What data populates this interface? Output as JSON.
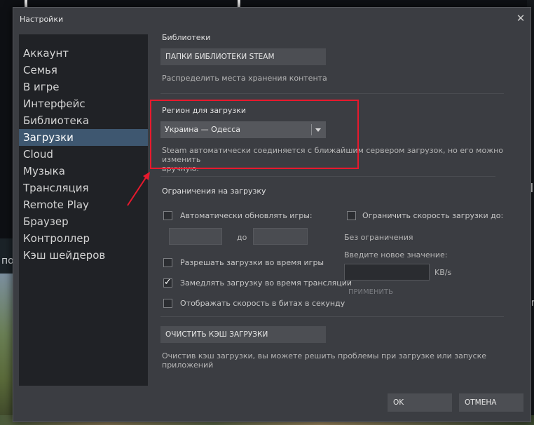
{
  "window": {
    "title": "Настройки"
  },
  "background": {
    "left_text": "по",
    "right_text_1": "Л",
    "right_text_2": "Cr"
  },
  "sidebar": {
    "items": [
      {
        "label": "Аккаунт"
      },
      {
        "label": "Семья"
      },
      {
        "label": "В игре"
      },
      {
        "label": "Интерфейс"
      },
      {
        "label": "Библиотека"
      },
      {
        "label": "Загрузки",
        "active": true
      },
      {
        "label": "Cloud"
      },
      {
        "label": "Музыка"
      },
      {
        "label": "Трансляция"
      },
      {
        "label": "Remote Play"
      },
      {
        "label": "Браузер"
      },
      {
        "label": "Контроллер"
      },
      {
        "label": "Кэш шейдеров"
      }
    ]
  },
  "libraries": {
    "heading": "Библиотеки",
    "button": "ПАПКИ БИБЛИОТЕКИ STEAM",
    "description": "Распределить места хранения контента"
  },
  "region": {
    "heading": "Регион для загрузки",
    "selected": "Украина — Одесса",
    "description_line1": "Steam автоматически соединяется с ближайшим сервером загрузок, но его можно изменить",
    "description_line2": "вручную."
  },
  "limits": {
    "heading": "Ограничения на загрузку",
    "auto_update": {
      "label": "Автоматически обновлять игры:",
      "checked": false
    },
    "time_to": "до",
    "limit_speed": {
      "label": "Ограничить скорость загрузки до:",
      "checked": false
    },
    "no_limit": "Без ограничения",
    "enter_value": "Введите новое значение:",
    "unit": "KB/s",
    "apply": "ПРИМЕНИТЬ",
    "allow_during_game": {
      "label": "Разрешать загрузки во время игры",
      "checked": false
    },
    "throttle_streaming": {
      "label": "Замедлять загрузку во время трансляции",
      "checked": true
    },
    "show_bits": {
      "label": "Отображать скорость в битах в секунду",
      "checked": false
    }
  },
  "cache": {
    "button": "ОЧИСТИТЬ КЭШ ЗАГРУЗКИ",
    "description": "Очистив кэш загрузки, вы можете решить проблемы при загрузке или запуске приложений"
  },
  "footer": {
    "ok": "OK",
    "cancel": "ОТМЕНА"
  },
  "colors": {
    "highlight": "#e8192d",
    "active_nav": "#3e5770",
    "dialog_bg": "#3b3d42"
  }
}
